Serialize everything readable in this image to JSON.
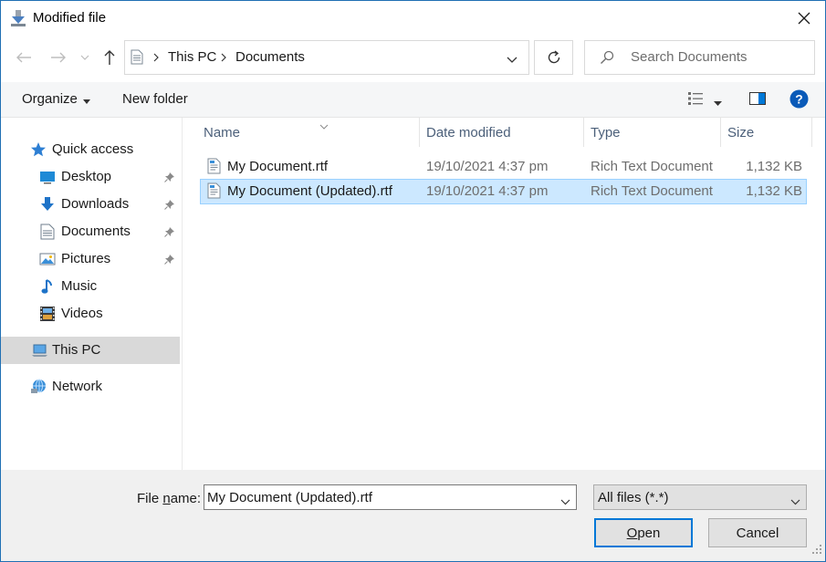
{
  "window": {
    "title": "Modified file"
  },
  "address": {
    "crumbs": [
      "This PC",
      "Documents"
    ]
  },
  "search": {
    "placeholder": "Search Documents"
  },
  "toolbar": {
    "organize": "Organize",
    "new_folder": "New folder"
  },
  "sidebar": {
    "quick_access": "Quick access",
    "items": [
      "Desktop",
      "Downloads",
      "Documents",
      "Pictures",
      "Music",
      "Videos"
    ],
    "this_pc": "This PC",
    "network": "Network"
  },
  "columns": {
    "name": "Name",
    "date": "Date modified",
    "type": "Type",
    "size": "Size"
  },
  "files": [
    {
      "name": "My Document.rtf",
      "date": "19/10/2021 4:37 pm",
      "type": "Rich Text Document",
      "size": "1,132 KB"
    },
    {
      "name": "My Document (Updated).rtf",
      "date": "19/10/2021 4:37 pm",
      "type": "Rich Text Document",
      "size": "1,132 KB"
    }
  ],
  "bottom": {
    "filename_label_pre": "File ",
    "filename_label_u": "n",
    "filename_label_post": "ame:",
    "filename_value": "My Document (Updated).rtf",
    "filter": "All files (*.*)",
    "open_u": "O",
    "open_rest": "pen",
    "cancel": "Cancel"
  },
  "colors": {
    "accent": "#0078d7",
    "selection": "#cce8ff",
    "selected_nav": "#d9d9d9"
  }
}
